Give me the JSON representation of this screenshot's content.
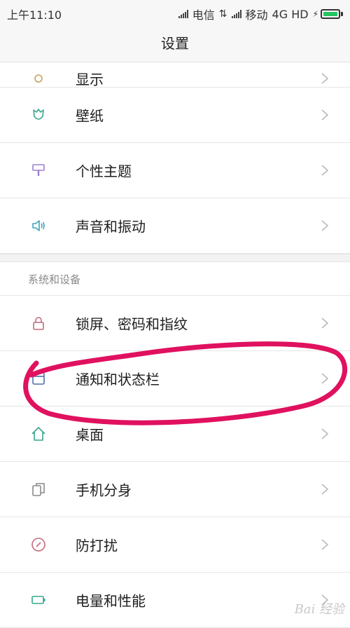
{
  "status_bar": {
    "time": "上午11:10",
    "carrier1": "电信",
    "carrier2": "移动",
    "network": "4G HD"
  },
  "header": {
    "title": "设置"
  },
  "top_partial": {
    "label": "显示"
  },
  "display_items": [
    {
      "label": "壁纸",
      "icon": "wallpaper-icon",
      "color": "#3aa58d"
    },
    {
      "label": "个性主题",
      "icon": "theme-brush-icon",
      "color": "#9b7fcf"
    },
    {
      "label": "声音和振动",
      "icon": "speaker-icon",
      "color": "#3aa6b9"
    }
  ],
  "section": {
    "title": "系统和设备",
    "items": [
      {
        "label": "锁屏、密码和指纹",
        "icon": "lock-icon",
        "color": "#c46a7a"
      },
      {
        "label": "通知和状态栏",
        "icon": "notification-icon",
        "color": "#4f6fa8"
      },
      {
        "label": "桌面",
        "icon": "home-icon",
        "color": "#3aa58d"
      },
      {
        "label": "手机分身",
        "icon": "dual-phone-icon",
        "color": "#8a8a8a"
      },
      {
        "label": "防打扰",
        "icon": "do-not-disturb-icon",
        "color": "#c46a7a"
      },
      {
        "label": "电量和性能",
        "icon": "battery-icon",
        "color": "#3aa58d"
      }
    ]
  },
  "annotation": {
    "color": "#e0115f"
  },
  "watermark": "Bai 经验"
}
